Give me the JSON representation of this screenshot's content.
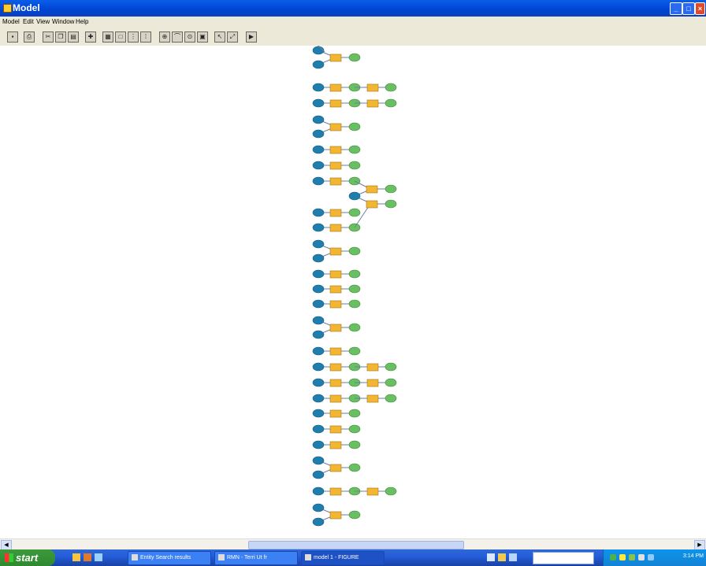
{
  "window": {
    "title": "Model"
  },
  "menu": [
    "Model",
    "Edit",
    "View",
    "Window",
    "Help"
  ],
  "toolbar": {
    "buttons": [
      "save-icon",
      "print-icon",
      "cut-icon",
      "copy-icon",
      "paste-icon",
      "add-data-icon",
      "grid-view-icon",
      "full-extent-icon",
      "select-icon",
      "select-all-icon",
      "zoom-in-icon",
      "pan-icon",
      "zoom-icon",
      "fixed-zoom-icon",
      "pointer-icon",
      "connect-icon",
      "run-icon"
    ]
  },
  "taskbar": {
    "start_label": "start",
    "tasks": [
      {
        "label": "Entity Search results"
      },
      {
        "label": "RMN - Terri Ut fr"
      },
      {
        "label": "model 1 - FIGURE"
      }
    ],
    "clock": "3:14 PM"
  },
  "colors": {
    "input": "#1f7eae",
    "tool": "#f2b631",
    "output": "#6bbf63",
    "connector": "#6a7fa0"
  },
  "model_rows": [
    {
      "type": "merge",
      "chain": 1
    },
    {
      "type": "row",
      "chain": 2
    },
    {
      "type": "row",
      "chain": 2
    },
    {
      "type": "merge",
      "chain": 1
    },
    {
      "type": "row",
      "chain": 1
    },
    {
      "type": "row",
      "chain": 1
    },
    {
      "type": "row",
      "chain": 1
    },
    {
      "type": "row",
      "chain": 1
    },
    {
      "type": "row",
      "chain": 1
    },
    {
      "type": "merge",
      "chain": 1
    },
    {
      "type": "row",
      "chain": 1
    },
    {
      "type": "row",
      "chain": 1
    },
    {
      "type": "row",
      "chain": 1
    },
    {
      "type": "merge",
      "chain": 1
    },
    {
      "type": "row",
      "chain": 1
    },
    {
      "type": "row",
      "chain": 2
    },
    {
      "type": "row",
      "chain": 2
    },
    {
      "type": "row",
      "chain": 2
    },
    {
      "type": "row",
      "chain": 1
    },
    {
      "type": "row",
      "chain": 1
    },
    {
      "type": "row",
      "chain": 1
    },
    {
      "type": "merge",
      "chain": 1
    },
    {
      "type": "row",
      "chain": 2
    },
    {
      "type": "merge",
      "chain": 1
    },
    {
      "type": "row",
      "chain": 1
    }
  ]
}
